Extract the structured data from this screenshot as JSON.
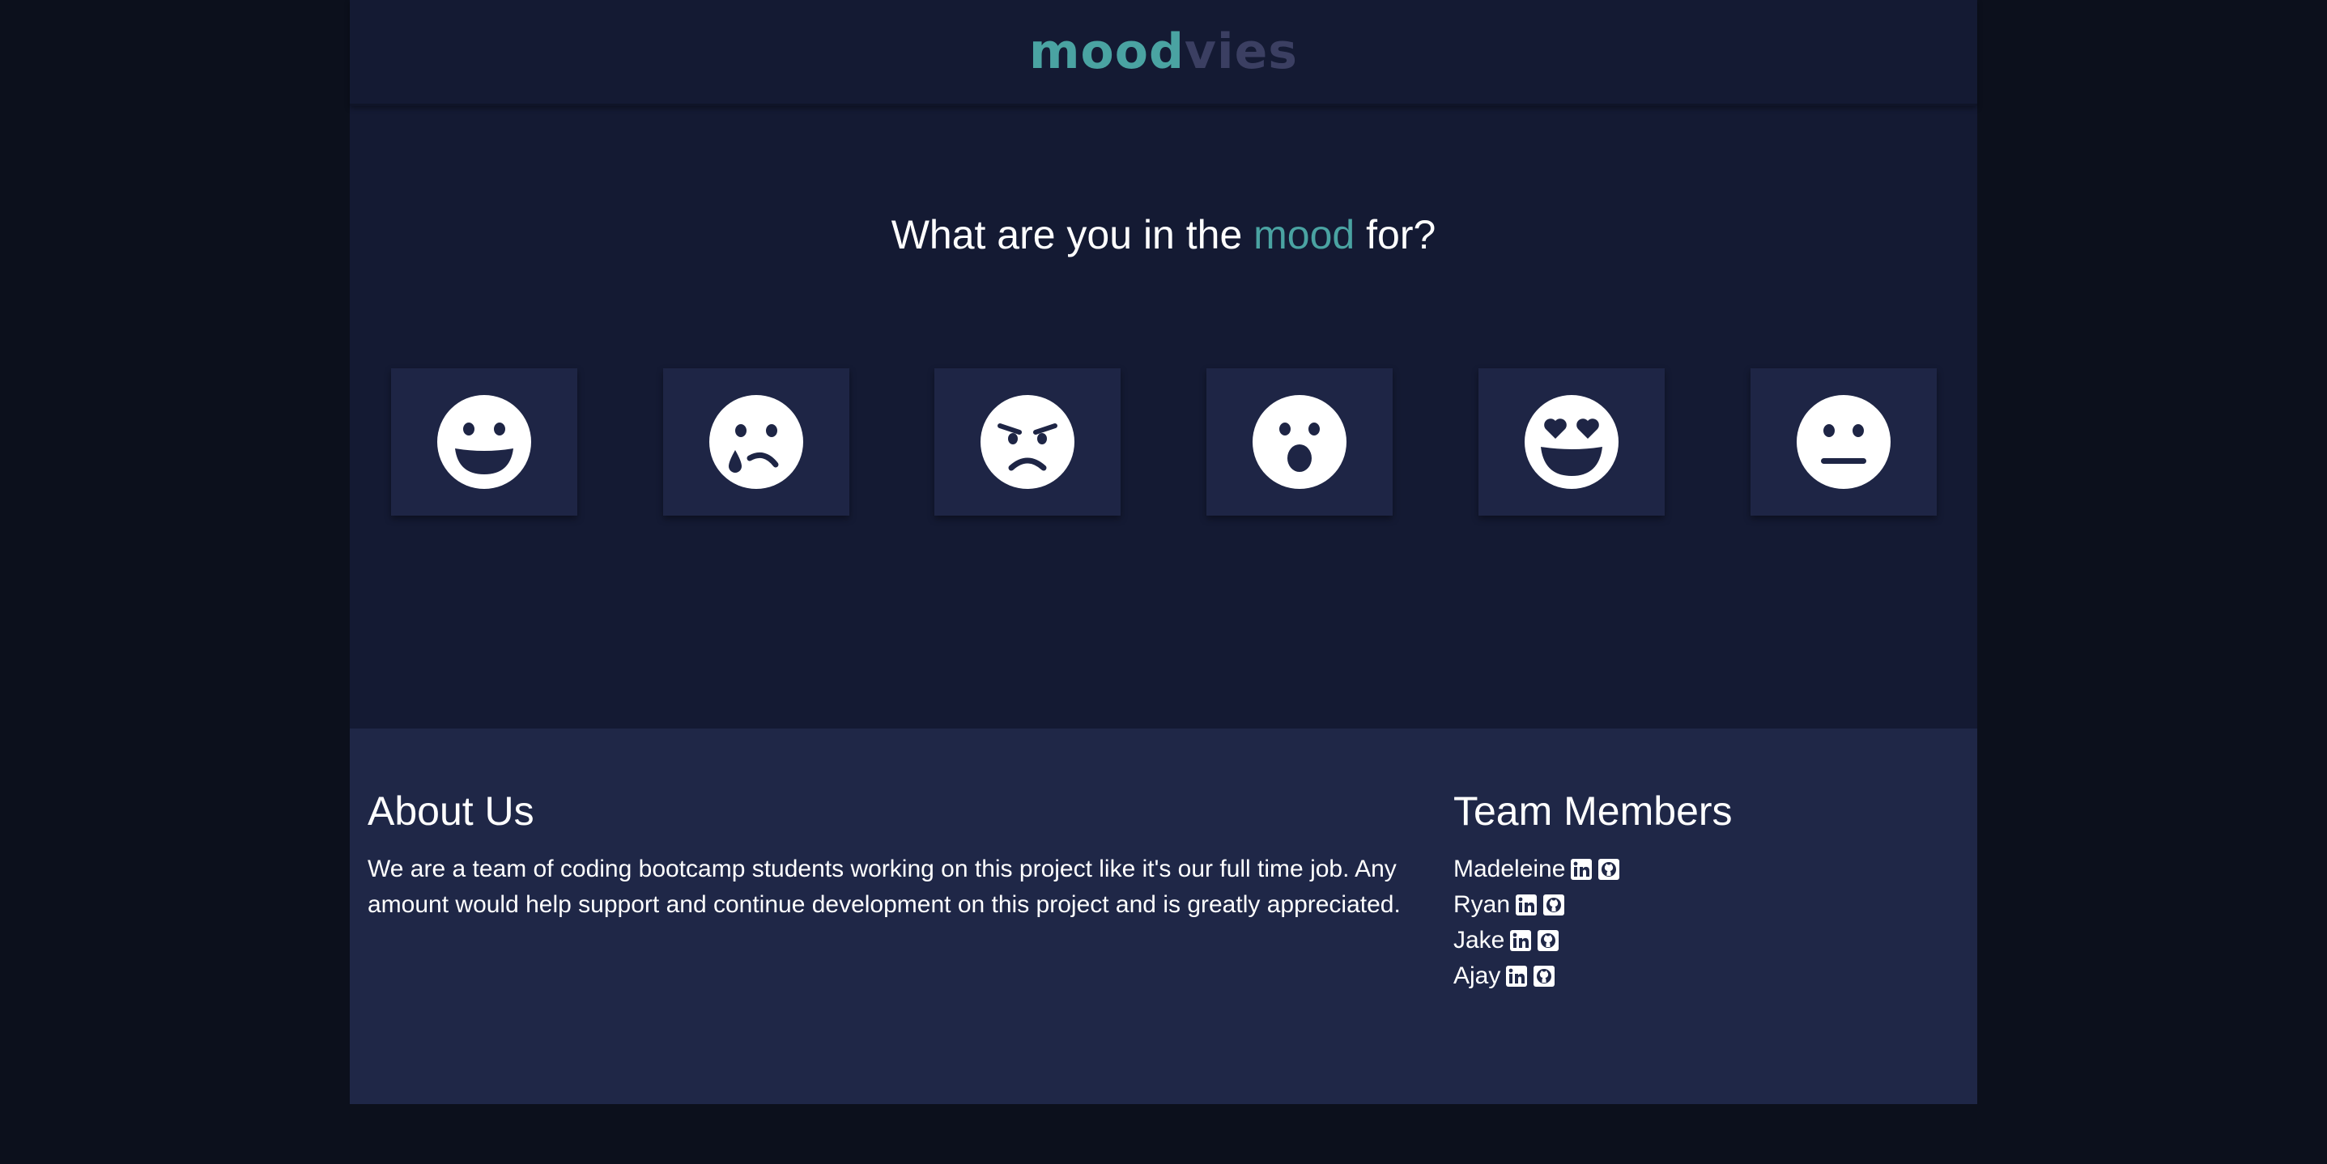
{
  "header": {
    "logo_part1": "mood",
    "logo_part2": "vies",
    "colors": {
      "accent": "#4aa3a2",
      "muted": "#3b3f62"
    }
  },
  "main": {
    "question_before": "What are you in the ",
    "question_accent": "mood",
    "question_after": " for?",
    "moods": [
      {
        "icon": "grinning-face-icon"
      },
      {
        "icon": "crying-face-icon"
      },
      {
        "icon": "angry-face-icon"
      },
      {
        "icon": "surprised-face-icon"
      },
      {
        "icon": "heart-eyes-face-icon"
      },
      {
        "icon": "neutral-face-icon"
      }
    ]
  },
  "footer": {
    "about_title": "About Us",
    "about_text": "We are a team of coding bootcamp students working on this project like it's our full time job. Any amount would help support and continue development on this project and is greatly appreciated.",
    "team_title": "Team Members",
    "members": [
      {
        "name": "Madeleine",
        "icons": [
          "linkedin-icon",
          "github-icon"
        ]
      },
      {
        "name": "Ryan",
        "icons": [
          "linkedin-icon",
          "github-icon"
        ]
      },
      {
        "name": "Jake",
        "icons": [
          "linkedin-icon",
          "github-icon"
        ]
      },
      {
        "name": "Ajay",
        "icons": [
          "linkedin-icon",
          "github-icon"
        ]
      }
    ]
  }
}
